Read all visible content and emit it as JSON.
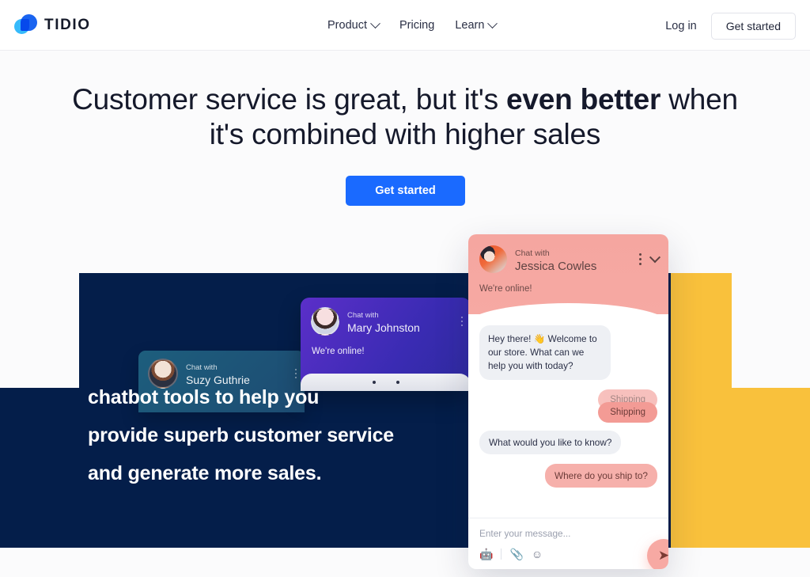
{
  "header": {
    "logo_text": "TIDIO",
    "logo_icon": "tidio-droplet-logo",
    "nav": [
      {
        "label": "Product",
        "has_dropdown": true
      },
      {
        "label": "Pricing",
        "has_dropdown": false
      },
      {
        "label": "Learn",
        "has_dropdown": true
      }
    ],
    "login_label": "Log in",
    "get_started_label": "Get started"
  },
  "hero": {
    "title_part1": "Customer service is great, but it's ",
    "title_bold": "even better",
    "title_part2": " when it's combined with higher sales",
    "cta_label": "Get started"
  },
  "panel": {
    "lines": [
      "chatbot tools to help you",
      "provide superb customer service",
      "and generate more sales."
    ]
  },
  "cards": {
    "suzy": {
      "chat_with_label": "Chat with",
      "name": "Suzy Guthrie"
    },
    "mary": {
      "chat_with_label": "Chat with",
      "name": "Mary Johnston",
      "status": "We're online!"
    }
  },
  "widget": {
    "chat_with_label": "Chat with",
    "agent_name": "Jessica Cowles",
    "status": "We're online!",
    "messages": [
      {
        "from": "bot",
        "text": "Hey there! 👋 Welcome to our store. What can we help you with today?"
      },
      {
        "from": "chip",
        "text": "Shipping"
      },
      {
        "from": "bot",
        "text": "What would you like to know?"
      },
      {
        "from": "user",
        "text": "Where do you ship to?"
      }
    ],
    "chip_ghost_label": "Shipping",
    "chip_label": "Shipping",
    "input_placeholder": "Enter your message...",
    "tools": [
      {
        "icon": "bot-icon",
        "glyph": "🤖"
      },
      {
        "icon": "paperclip-icon",
        "glyph": "📎"
      },
      {
        "icon": "emoji-icon",
        "glyph": "☺"
      }
    ],
    "send_icon": "send-icon",
    "send_glyph": "➤"
  },
  "colors": {
    "brand_blue": "#1a6aff",
    "navy_panel": "#041e4a",
    "yellow_block": "#f9c13c",
    "widget_pink": "#f5a6a0",
    "purple_card": "#3a2bb3",
    "teal_card": "#1d5e7d"
  }
}
